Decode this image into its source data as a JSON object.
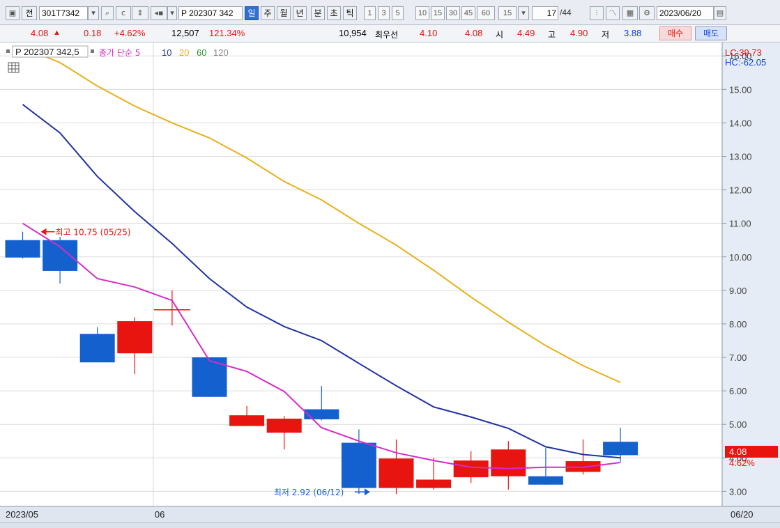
{
  "toolbar": {
    "prev_label": "전",
    "code": "301T7342",
    "symbol": "P 202307 342",
    "periods": [
      "일",
      "주",
      "월",
      "년",
      "분",
      "초",
      "틱"
    ],
    "intervals": [
      "1",
      "3",
      "5",
      "10",
      "15",
      "30",
      "45",
      "60"
    ],
    "interval_value": "15",
    "page_current": "17",
    "page_total": "/44",
    "date": "2023/06/20"
  },
  "infobar": {
    "price": "4.08",
    "change": "0.18",
    "change_pct": "+4.62%",
    "volume": "12,507",
    "volume_ratio": "121.34%",
    "best_bid_qty": "10,954",
    "best_bid_label": "최우선",
    "best_bid": "4.10",
    "best_ask": "4.08",
    "open_label": "시",
    "open": "4.49",
    "high_label": "고",
    "high": "4.90",
    "low_label": "저",
    "low": "3.88",
    "buy_label": "매수",
    "sell_label": "매도"
  },
  "legend": {
    "symbol_label": "P 202307 342,5",
    "ma_label": "종가 단순 5",
    "periods": [
      "10",
      "20",
      "60",
      "120"
    ]
  },
  "colors": {
    "up": "#e8140f",
    "down": "#1560cf",
    "ma5": "#d42cc8",
    "ma10": "#1f33a0",
    "ma20": "#e8b018",
    "ma60": "#2a9a2a",
    "ma120": "#888888",
    "grid": "#dcdcdc"
  },
  "chart_data": {
    "type": "candlestick",
    "lc_label": "LC:39.73",
    "hc_label": "HC:-62.05",
    "ylim": [
      2.55,
      16.4
    ],
    "yticks": [
      3,
      4,
      5,
      6,
      7,
      8,
      9,
      10,
      11,
      12,
      13,
      14,
      15,
      16
    ],
    "ytick_labels": [
      "3.00",
      "4.00",
      "5.00",
      "6.00",
      "7.00",
      "8.00",
      "9.00",
      "10.00",
      "11.00",
      "12.00",
      "13.00",
      "14.00",
      "15.00",
      "16.00"
    ],
    "x_labels": [
      {
        "index": 0,
        "text": "2023/05"
      },
      {
        "index": 4,
        "text": "06"
      },
      {
        "index": 16,
        "text": "06/20"
      }
    ],
    "candles": [
      {
        "o": 10.5,
        "h": 10.75,
        "l": 9.95,
        "c": 9.98
      },
      {
        "o": 10.5,
        "h": 10.6,
        "l": 9.2,
        "c": 9.58
      },
      {
        "o": 7.7,
        "h": 7.9,
        "l": 6.85,
        "c": 6.85
      },
      {
        "o": 7.12,
        "h": 8.2,
        "l": 6.5,
        "c": 8.08
      },
      {
        "o": 8.42,
        "h": 9.0,
        "l": 7.95,
        "c": 8.42
      },
      {
        "o": 7.0,
        "h": 7.0,
        "l": 5.82,
        "c": 5.82
      },
      {
        "o": 4.95,
        "h": 5.55,
        "l": 4.95,
        "c": 5.27
      },
      {
        "o": 4.75,
        "h": 5.25,
        "l": 4.25,
        "c": 5.17
      },
      {
        "o": 5.45,
        "h": 6.15,
        "l": 5.12,
        "c": 5.15
      },
      {
        "o": 4.45,
        "h": 4.85,
        "l": 2.92,
        "c": 3.1
      },
      {
        "o": 3.1,
        "h": 4.55,
        "l": 2.92,
        "c": 3.98
      },
      {
        "o": 3.1,
        "h": 4.0,
        "l": 3.05,
        "c": 3.35
      },
      {
        "o": 3.42,
        "h": 4.2,
        "l": 3.25,
        "c": 3.92
      },
      {
        "o": 3.45,
        "h": 4.5,
        "l": 3.05,
        "c": 4.25
      },
      {
        "o": 3.45,
        "h": 4.3,
        "l": 3.2,
        "c": 3.2
      },
      {
        "o": 3.58,
        "h": 4.55,
        "l": 3.5,
        "c": 3.9
      },
      {
        "o": 4.48,
        "h": 4.9,
        "l": 3.88,
        "c": 4.08
      }
    ],
    "series": [
      {
        "name": "5",
        "values": [
          11.0,
          10.3,
          9.35,
          9.1,
          8.7,
          6.9,
          6.58,
          5.98,
          4.9,
          4.5,
          4.15,
          3.92,
          3.72,
          3.68,
          3.72,
          3.72,
          3.86
        ]
      },
      {
        "name": "10",
        "values": [
          14.55,
          13.7,
          12.4,
          11.35,
          10.4,
          9.35,
          8.5,
          7.92,
          7.5,
          6.82,
          6.15,
          5.52,
          5.22,
          4.88,
          4.33,
          4.1,
          4.0
        ]
      },
      {
        "name": "20",
        "values": [
          16.25,
          15.8,
          15.1,
          14.5,
          14.0,
          13.55,
          12.95,
          12.25,
          11.7,
          11.0,
          10.35,
          9.6,
          8.8,
          8.05,
          7.35,
          6.75,
          6.25
        ]
      }
    ],
    "annotations": [
      {
        "text": "최고 10.75 (05/25)",
        "index": 0,
        "value": 10.75,
        "kind": "high"
      },
      {
        "text": "최저 2.92 (06/12)",
        "index": 9,
        "value": 2.92,
        "kind": "low"
      }
    ],
    "price_tag": "4.08",
    "pct_tag": "4.62%"
  }
}
